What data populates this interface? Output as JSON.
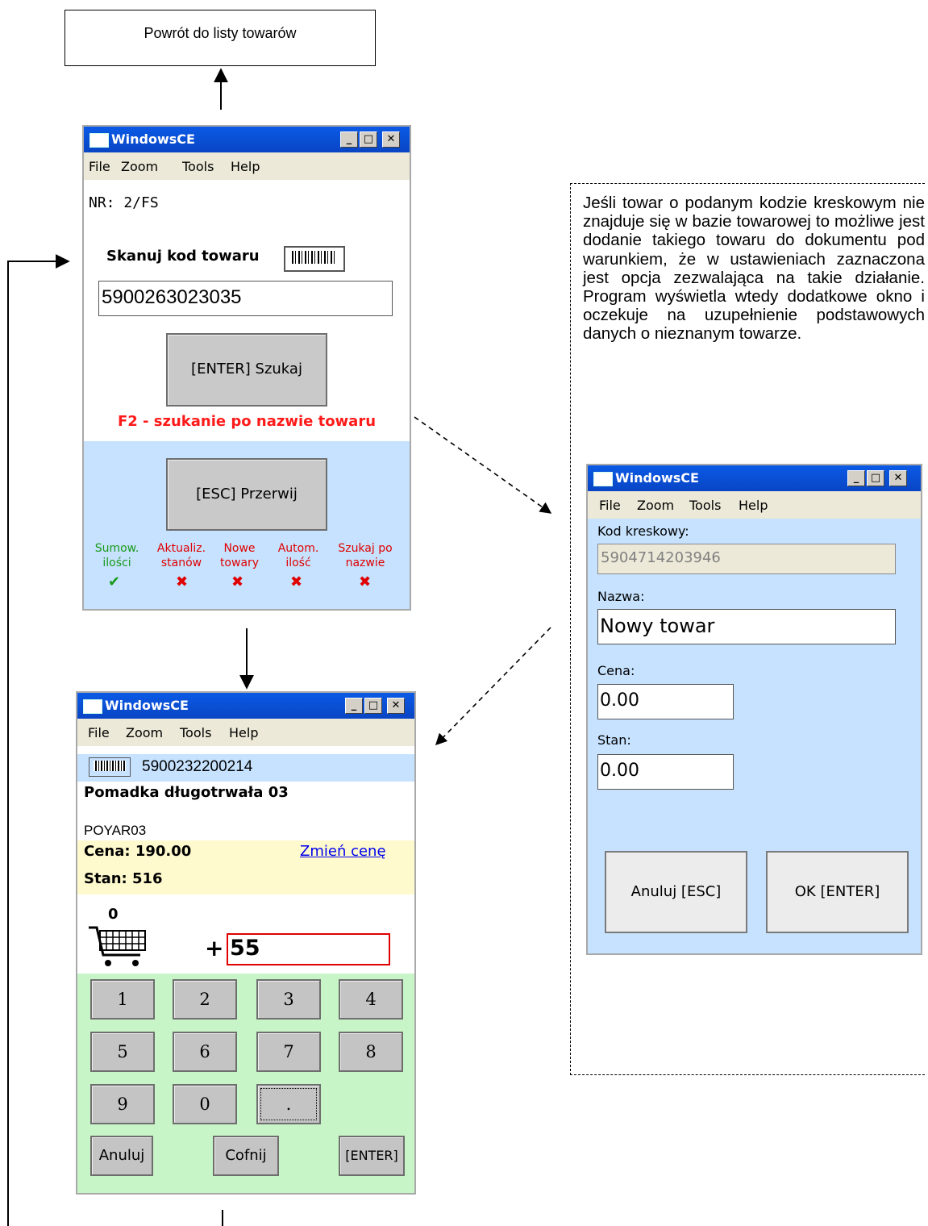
{
  "back_box": {
    "label": "Powrót do listy towarów"
  },
  "note": {
    "text": "Jeśli towar o podanym kodzie kreskowym nie znajduje się w bazie towarowej to możliwe jest dodanie takiego towaru do dokumentu pod warunkiem, że w ustawieniach zaznaczona jest opcja zezwalająca na takie działanie. Program wyświetla wtedy dodatkowe okno i oczekuje na uzupełnienie podstawowych danych o nieznanym towarze."
  },
  "window_common": {
    "title": "WindowsCE",
    "menu": [
      "File",
      "Zoom",
      "Tools",
      "Help"
    ],
    "controls": {
      "minimize": "_",
      "maximize": "□",
      "close": "✕"
    }
  },
  "scan_window": {
    "doc_number": "NR: 2/FS",
    "scan_label": "Skanuj kod towaru",
    "barcode_value": "5900263023035",
    "search_button": "[ENTER] Szukaj",
    "hint": "F2 - szukanie po nazwie towaru",
    "cancel_button": "[ESC] Przerwij",
    "flags": [
      {
        "line1": "Sumow.",
        "line2": "ilości",
        "state": "✔",
        "color": "#1a9a1a"
      },
      {
        "line1": "Aktualiz.",
        "line2": "stanów",
        "state": "✖",
        "color": "#e00000"
      },
      {
        "line1": "Nowe",
        "line2": "towary",
        "state": "✖",
        "color": "#e00000"
      },
      {
        "line1": "Autom.",
        "line2": "ilość",
        "state": "✖",
        "color": "#e00000"
      },
      {
        "line1": "Szukaj po",
        "line2": "nazwie",
        "state": "✖",
        "color": "#e00000"
      }
    ]
  },
  "qty_window": {
    "barcode": "5900232200214",
    "product_name": "Pomadka długotrwała 03",
    "product_code": "POYAR03",
    "price": "Cena: 190.00",
    "change_price_link": "Zmień cenę",
    "stock": "Stan: 516",
    "cart_count": "0",
    "plus": "+",
    "quantity": "55",
    "keys": [
      "1",
      "2",
      "3",
      "4",
      "5",
      "6",
      "7",
      "8",
      "9",
      "0",
      "."
    ],
    "cancel": "Anuluj",
    "back": "Cofnij",
    "enter": "[ENTER]"
  },
  "new_item_window": {
    "barcode_label": "Kod kreskowy:",
    "barcode_value": "5904714203946",
    "name_label": "Nazwa:",
    "name_value": "Nowy towar",
    "price_label": "Cena:",
    "price_value": "0.00",
    "stock_label": "Stan:",
    "stock_value": "0.00",
    "cancel_button": "Anuluj [ESC]",
    "ok_button": "OK  [ENTER]"
  },
  "colors": {
    "title_bar": "#0a5ae6",
    "menu_bg": "#ece9d8",
    "light_blue": "#c6e2ff",
    "light_green": "#c8f5c8",
    "light_yellow": "#fffacd",
    "hint_red": "#ff1a1a",
    "link_blue": "#0000ee"
  }
}
